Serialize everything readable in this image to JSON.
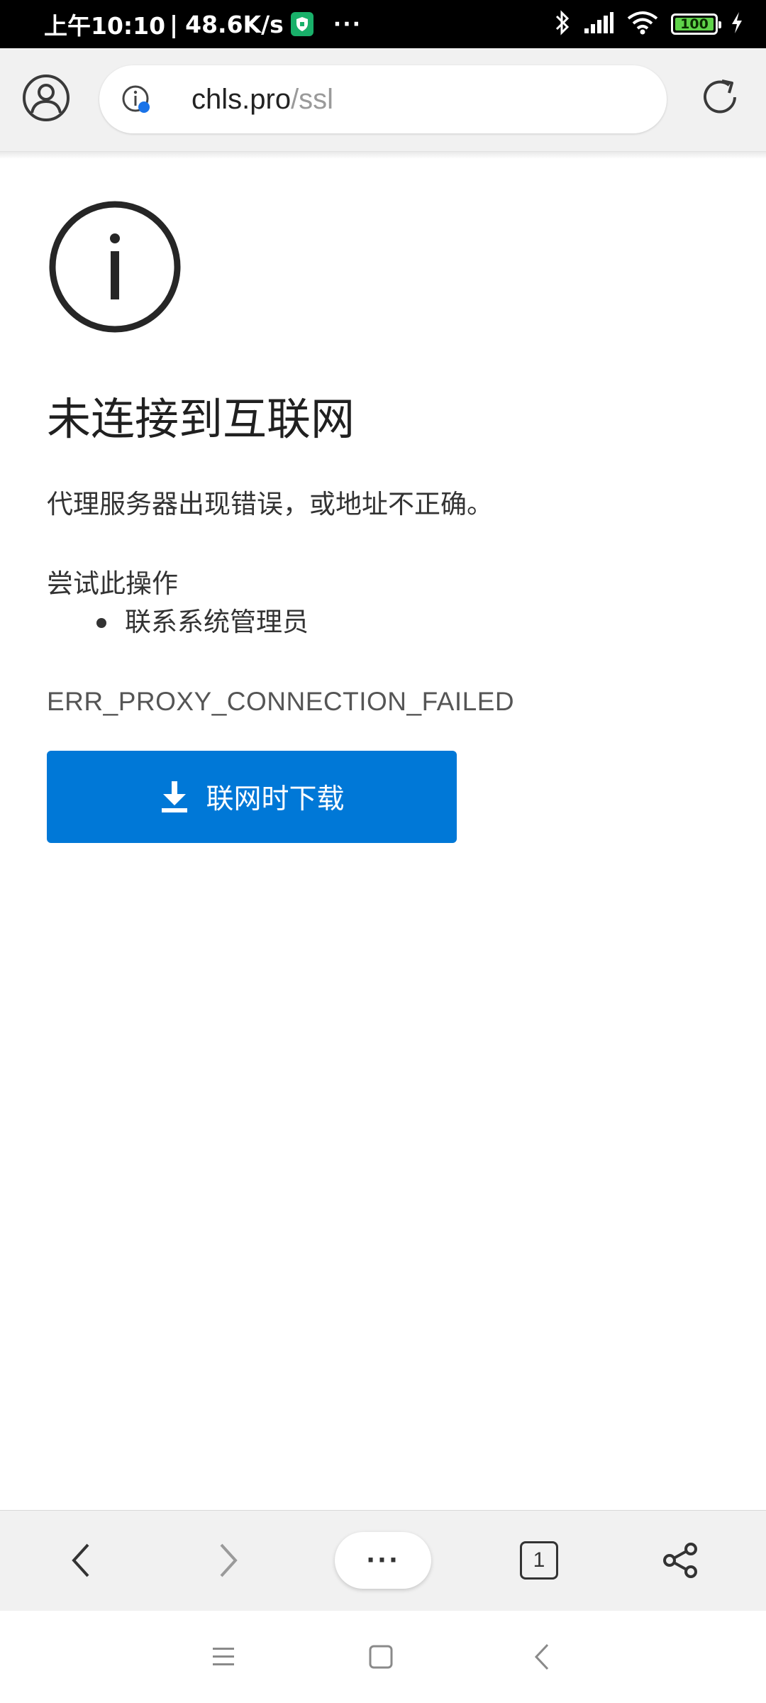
{
  "status_bar": {
    "time": "上午10:10",
    "separator": "|",
    "network_speed": "48.6K/s",
    "more": "···",
    "battery_level": "100",
    "battery_fraction": 1.0
  },
  "address_bar": {
    "url_host": "chls.pro",
    "url_path": "/ssl"
  },
  "error_page": {
    "title": "未连接到互联网",
    "description": "代理服务器出现错误，或地址不正确。",
    "suggestions_heading": "尝试此操作",
    "suggestions": [
      "联系系统管理员"
    ],
    "error_code": "ERR_PROXY_CONNECTION_FAILED",
    "download_button_label": "联网时下载"
  },
  "bottom_bar": {
    "menu_label": "···",
    "tab_count": "1"
  },
  "colors": {
    "accent": "#0078d7",
    "status_bar_bg": "#000000",
    "toolbar_bg": "#f1f1f1",
    "shield_badge": "#19b06a",
    "battery_fill": "#5fd34a"
  },
  "icons": {
    "profile": "person-icon",
    "site_info": "info-icon",
    "reload": "reload-icon",
    "error": "info-circle-icon",
    "download": "download-icon",
    "back": "chevron-left-icon",
    "forward": "chevron-right-icon",
    "tabs": "tabs-icon",
    "share": "share-icon"
  }
}
